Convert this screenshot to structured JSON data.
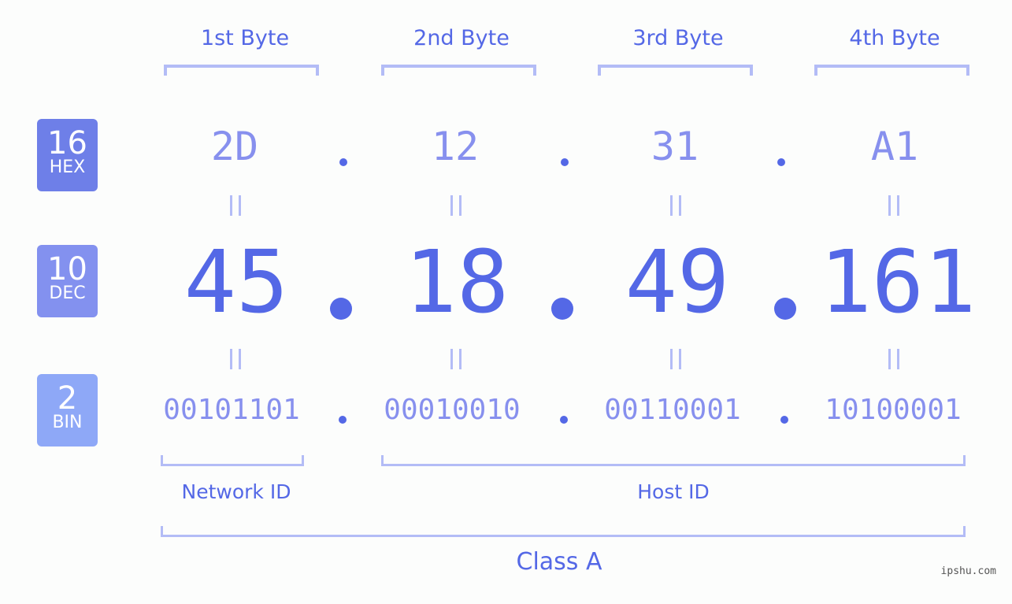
{
  "bytes": [
    {
      "label": "1st Byte",
      "hex": "2D",
      "dec": "45",
      "bin": "00101101"
    },
    {
      "label": "2nd Byte",
      "hex": "12",
      "dec": "18",
      "bin": "00010010"
    },
    {
      "label": "3rd Byte",
      "hex": "31",
      "dec": "49",
      "bin": "00110001"
    },
    {
      "label": "4th Byte",
      "hex": "A1",
      "dec": "161",
      "bin": "10100001"
    }
  ],
  "badges": {
    "hex": {
      "number": "16",
      "label": "HEX",
      "color": "#6e7fe8"
    },
    "dec": {
      "number": "10",
      "label": "DEC",
      "color": "#8391ef"
    },
    "bin": {
      "number": "2",
      "label": "BIN",
      "color": "#8ea8f7"
    }
  },
  "groups": {
    "network": "Network ID",
    "host": "Host ID",
    "class": "Class A"
  },
  "watermark": "ipshu.com",
  "colors": {
    "accent": "#5468e6",
    "light_text": "#8790ee",
    "bracket": "#b3bcf6"
  }
}
